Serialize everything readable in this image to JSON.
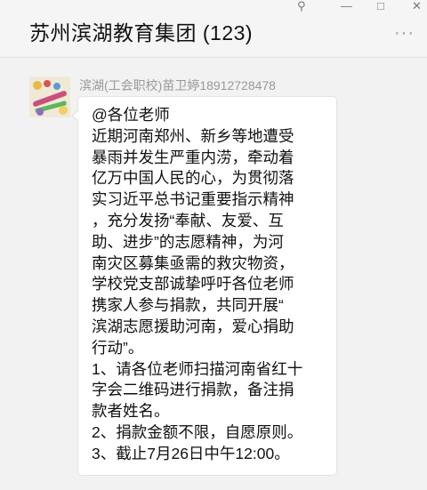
{
  "window": {
    "title": "苏州滨湖教育集团 (123)",
    "controls": [
      "⚲",
      "—",
      "□",
      "✕"
    ],
    "more_label": "···"
  },
  "message": {
    "sender": "滨湖(工会职校)苗卫婷18912728478",
    "lines": [
      "@各位老师",
      "近期河南郑州、新乡等地遭受",
      "暴雨并发生严重内涝，牵动着",
      "亿万中国人民的心，为贯彻落",
      "实习近平总书记重要指示精神",
      "，充分发扬“奉献、友爱、互",
      "助、进步”的志愿精神，为河",
      "南灾区募集亟需的救灾物资，",
      "学校党支部诚挚呼吁各位老师",
      "携家人参与捐款，共同开展“",
      "滨湖志愿援助河南，爱心捐助",
      "行动”。",
      "1、请各位老师扫描河南省红十",
      "字会二维码进行捐款，备注捐",
      "款者姓名。",
      "2、捐款金额不限，自愿原则。",
      "3、截止7月26日中午12:00。"
    ]
  }
}
